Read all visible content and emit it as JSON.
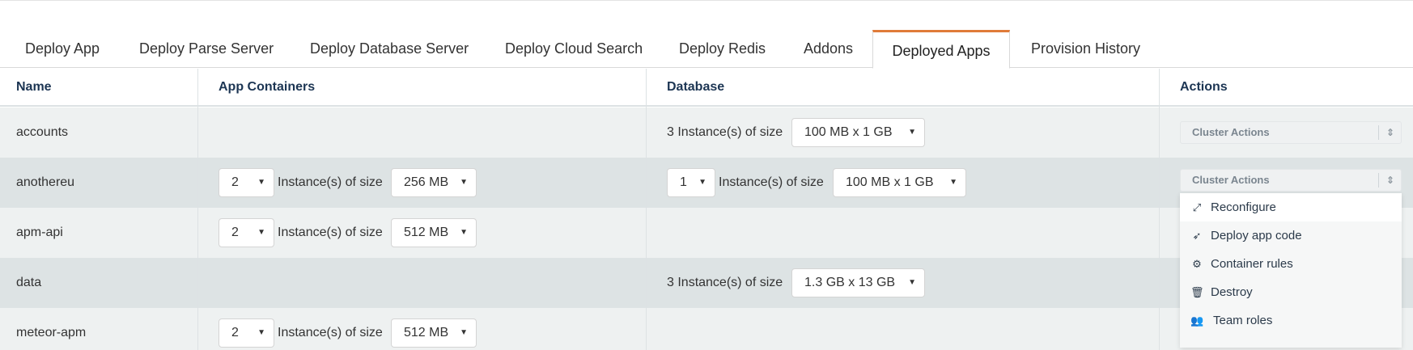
{
  "tabs": [
    {
      "label": "Deploy App"
    },
    {
      "label": "Deploy Parse Server"
    },
    {
      "label": "Deploy Database Server"
    },
    {
      "label": "Deploy Cloud Search"
    },
    {
      "label": "Deploy Redis"
    },
    {
      "label": "Addons"
    },
    {
      "label": "Deployed Apps",
      "active": true
    },
    {
      "label": "Provision History"
    }
  ],
  "accent_color": "#e07b39",
  "table": {
    "headers": {
      "name": "Name",
      "containers": "App Containers",
      "database": "Database",
      "actions": "Actions"
    },
    "instance_label": "Instance(s) of size",
    "rows": [
      {
        "name": "accounts",
        "db_text": "3 Instance(s) of size",
        "db_size": "100 MB x 1 GB",
        "action": "Cluster Actions"
      },
      {
        "name": "anothereu",
        "app_count": "2",
        "app_size": "256 MB",
        "db_count": "1",
        "db_size": "100 MB x 1 GB",
        "action": "Cluster Actions"
      },
      {
        "name": "apm-api",
        "app_count": "2",
        "app_size": "512 MB"
      },
      {
        "name": "data",
        "db_text": "3 Instance(s) of size",
        "db_size": "1.3 GB x 13 GB"
      },
      {
        "name": "meteor-apm",
        "app_count": "2",
        "app_size": "512 MB"
      }
    ]
  },
  "dropdown_menu": [
    {
      "label": "Reconfigure",
      "icon": "expand-icon"
    },
    {
      "label": "Deploy app code",
      "icon": "rocket-icon"
    },
    {
      "label": "Container rules",
      "icon": "gear-icon"
    },
    {
      "label": "Destroy",
      "icon": "trash-icon"
    },
    {
      "label": "Team roles",
      "icon": "users-icon"
    }
  ]
}
